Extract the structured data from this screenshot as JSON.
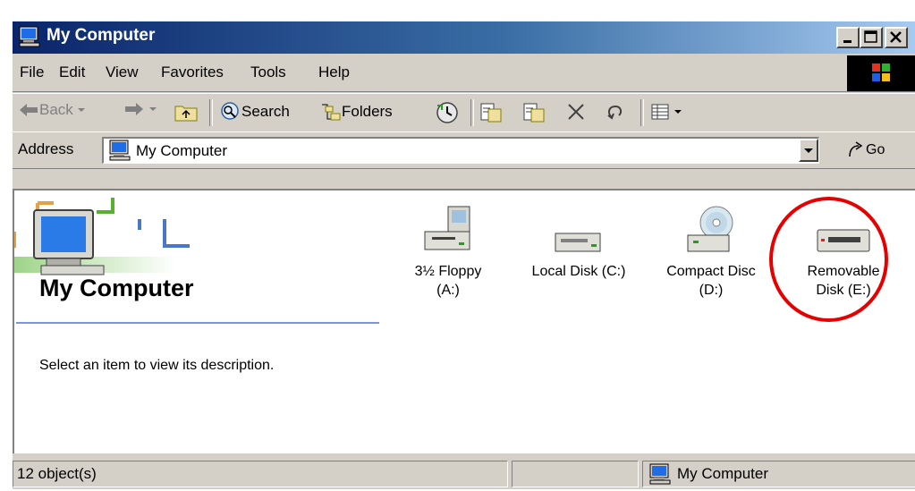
{
  "window": {
    "title": "My Computer",
    "icon": "my-computer-icon"
  },
  "menu": {
    "items": [
      "File",
      "Edit",
      "View",
      "Favorites",
      "Tools",
      "Help"
    ]
  },
  "toolbar": {
    "back": "Back",
    "search": "Search",
    "folders": "Folders"
  },
  "address": {
    "label": "Address",
    "value": "My Computer",
    "go": "Go"
  },
  "panel": {
    "title": "My Computer",
    "description": "Select an item to view its description."
  },
  "drives": [
    {
      "line1": "3½ Floppy",
      "line2": "(A:)",
      "icon": "floppy-drive-icon"
    },
    {
      "line1": "Local Disk (C:)",
      "line2": "",
      "icon": "hard-disk-icon"
    },
    {
      "line1": "Compact Disc",
      "line2": "(D:)",
      "icon": "cd-drive-icon"
    },
    {
      "line1": "Removable",
      "line2": "Disk (E:)",
      "icon": "removable-disk-icon"
    }
  ],
  "status": {
    "count": "12 object(s)",
    "location": "My Computer"
  },
  "colors": {
    "titlebar_start": "#0a246a",
    "titlebar_end": "#a6caf0",
    "highlight_circle": "#e60000",
    "face": "#d4d0c8"
  }
}
